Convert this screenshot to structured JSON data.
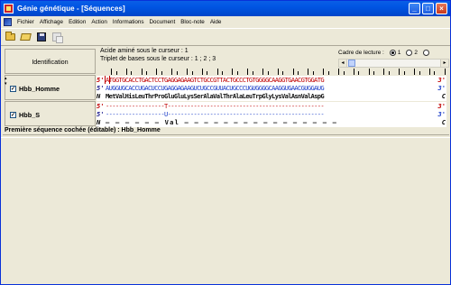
{
  "window": {
    "title": "Génie génétique - [Séquences]",
    "min_label": "_",
    "max_label": "□",
    "close_label": "×"
  },
  "menu": [
    "Fichier",
    "Affichage",
    "Edition",
    "Action",
    "Informations",
    "Document",
    "Bloc-note",
    "Aide"
  ],
  "toolbar": {
    "buttons": [
      "open-folder-icon",
      "open-document-icon",
      "save-icon",
      "copy-icon"
    ]
  },
  "panel": {
    "id_header": "Identification",
    "amino_info": "Acide aminé sous le curseur : 1",
    "triplet_info": "Triplet de bases sous le curseur : 1 ; 2 ; 3",
    "frame_label": "Cadre de lecture :",
    "frame_options": [
      "1",
      "2",
      "3"
    ],
    "frame_selected": "1"
  },
  "sequences": [
    {
      "name": "Hbb_Homme",
      "checked": true,
      "strand_5": "5'",
      "strand_3": "3'",
      "dna_first": "A",
      "dna_rest": "TGGTGCACCTGACTCCTGAGGAGAAGTCTGCCGTTACTGCCCTGTGGGGCAAGGTGAACGTGGATG",
      "rna_label_5": "5'",
      "rna_label_3": "3'",
      "rna": "AUGGUGCACCUGACUCCUGAGGAGAAGUCUGCCGUUACUGCCCUGUGGGGCAAGGUGAACGUGGAUG",
      "prot_label_n": "N",
      "prot_label_c": "C",
      "protein": "MetValHisLeuThrProGluGluLysSerAlaValThrAlaLeuTrpGlyLysValAsnValAspG"
    },
    {
      "name": "Hbb_S",
      "checked": true,
      "strand_5": "5'",
      "strand_3": "3'",
      "dna": "------------------T------------------------------------------------",
      "rna_label_5": "5'",
      "rna_label_3": "3'",
      "rna": "------------------U------------------------------------------------",
      "prot_label_n": "N",
      "prot_label_c": "C",
      "protein": "— — — — — — Val — — — — — — — — — — — — — — — —"
    }
  ],
  "status": "Première séquence cochée (éditable) : Hbb_Homme",
  "colors": {
    "title_bar": "#0054e3",
    "window_bg": "#ece9d8",
    "strand_red": "#c00000",
    "rna_blue": "#1a3cc8"
  }
}
